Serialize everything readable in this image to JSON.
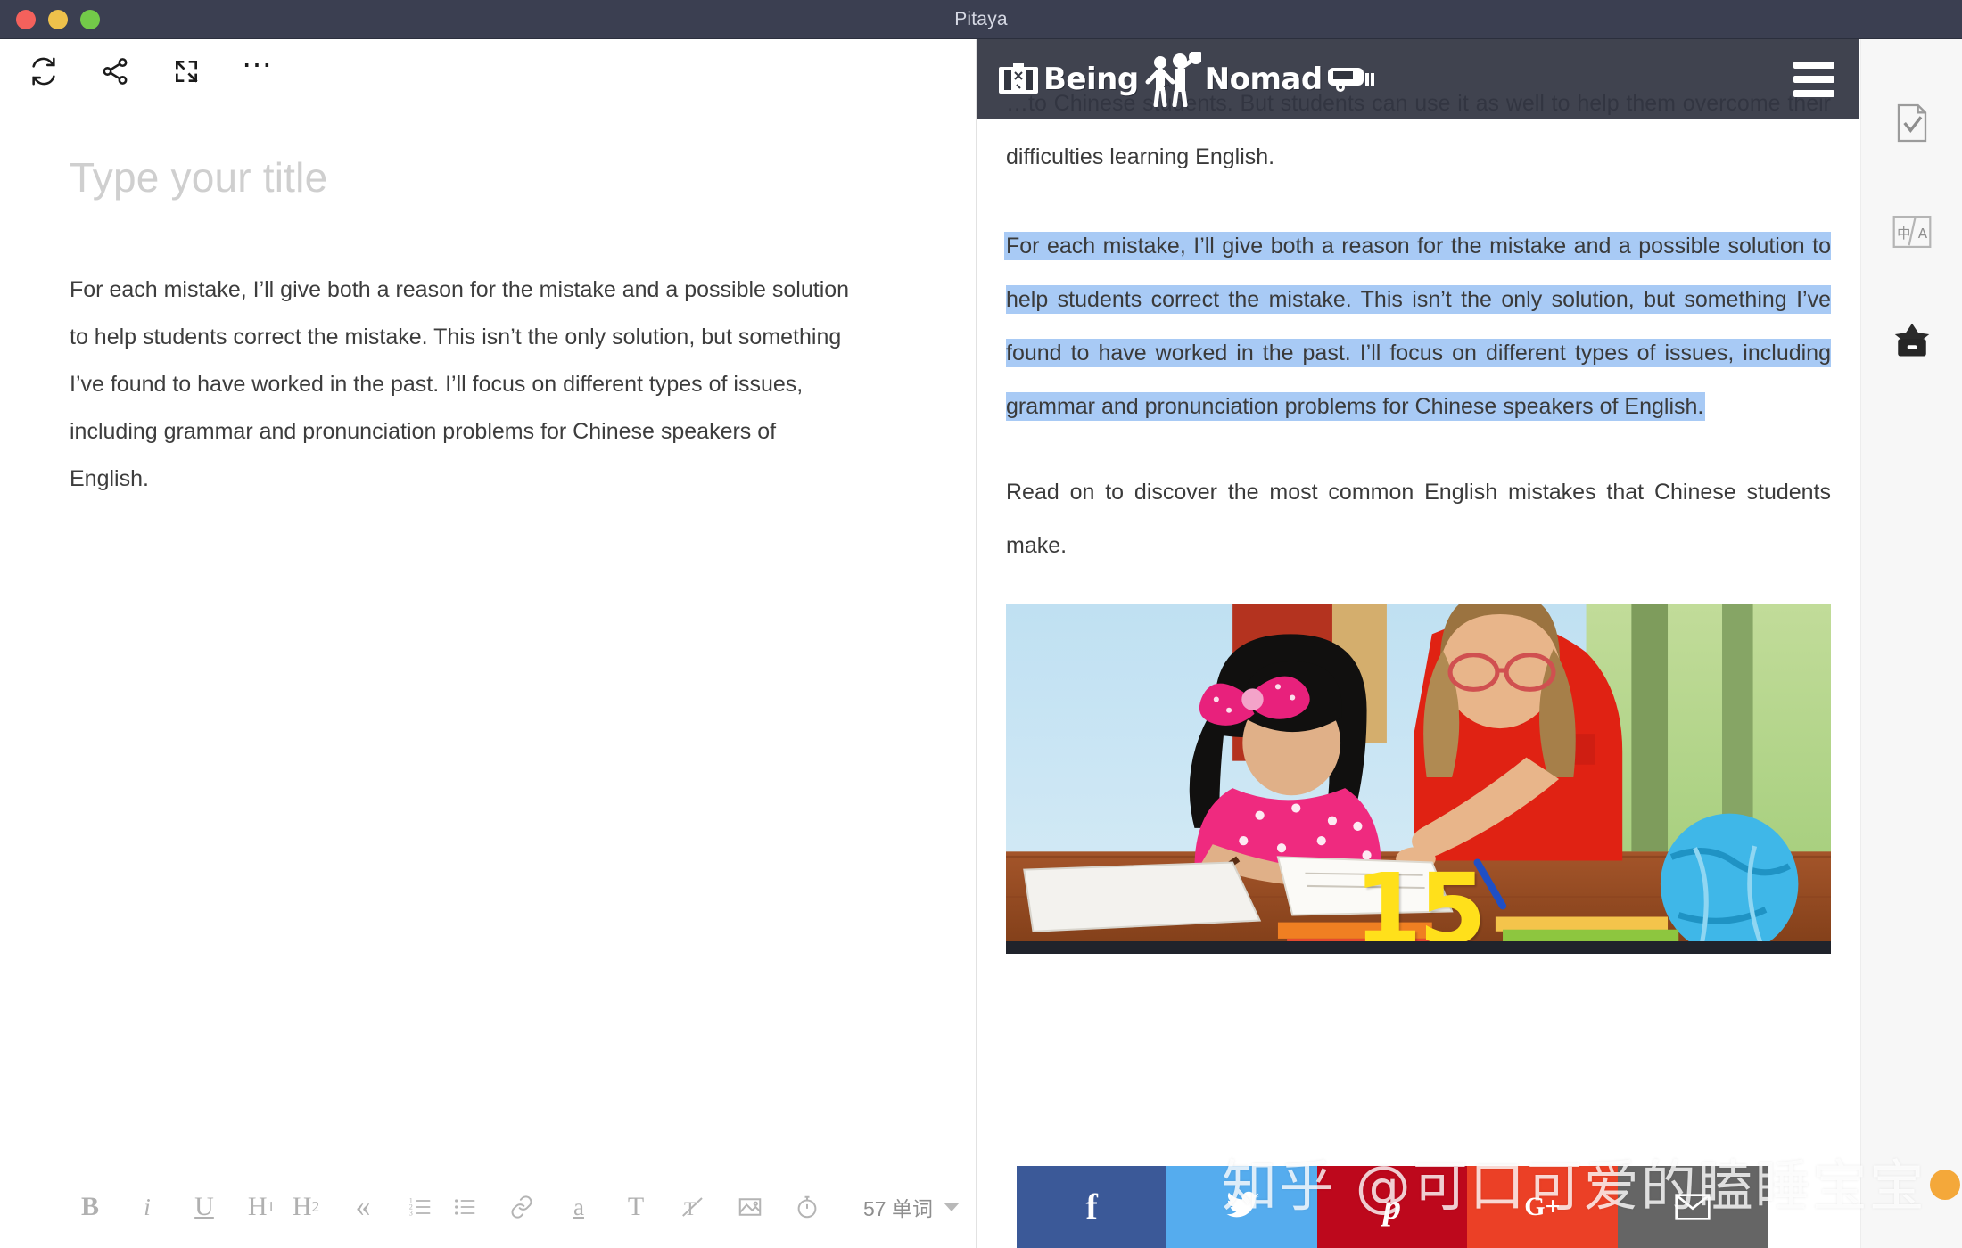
{
  "window": {
    "title": "Pitaya",
    "traffic_lights": [
      {
        "name": "close",
        "color": "#f4615c"
      },
      {
        "name": "minimize",
        "color": "#eec14b"
      },
      {
        "name": "zoom",
        "color": "#73c949"
      }
    ]
  },
  "editor": {
    "toolbar": [
      {
        "name": "sync-icon",
        "label": "Sync"
      },
      {
        "name": "share-icon",
        "label": "Share"
      },
      {
        "name": "fullscreen-icon",
        "label": "Fullscreen"
      },
      {
        "name": "more-icon",
        "label": "More"
      }
    ],
    "title_placeholder": "Type your title",
    "body": "For each mistake, I’ll give both a reason for the mistake and a possible solution to help students correct the mistake. This isn’t the only solution, but something I’ve found to have worked in the past. I’ll focus on different types of issues, including grammar and pronunciation problems for Chinese speakers of English."
  },
  "format_bar": {
    "items": [
      {
        "name": "bold-button",
        "label": "B"
      },
      {
        "name": "italic-button",
        "label": "i"
      },
      {
        "name": "underline-button",
        "label": "U"
      },
      {
        "name": "heading-1-button",
        "label": "H1"
      },
      {
        "name": "heading-2-button",
        "label": "H2"
      },
      {
        "name": "blockquote-button",
        "label": "“"
      },
      {
        "name": "ordered-list-button",
        "label": "ordered-list"
      },
      {
        "name": "bullet-list-button",
        "label": "bullet-list"
      },
      {
        "name": "link-button",
        "label": "link"
      },
      {
        "name": "highlight-button",
        "label": "a"
      },
      {
        "name": "text-style-button",
        "label": "T"
      },
      {
        "name": "clear-format-button",
        "label": "Tx"
      },
      {
        "name": "insert-image-button",
        "label": "image"
      },
      {
        "name": "timer-button",
        "label": "timer"
      }
    ],
    "word_count": "57 单词"
  },
  "preview": {
    "site_logo": "Being Nomad",
    "menu_label": "menu",
    "paragraph_top": "…to Chinese students. But students can use it as well to help them overcome their difficulties learning English.",
    "paragraph_highlighted": "For each mistake, I’ll give both a reason for the mistake and a possible solution to help students correct the mistake. This isn’t the only solution, but something I’ve found to have worked in the past. I’ll focus on different types of issues, including grammar and pronunciation problems for Chinese speakers of English.",
    "paragraph_after": "Read on to discover the most common English mistakes that Chinese students make.",
    "photo_number": "15",
    "highlight_color": "#a8caf5",
    "social": [
      {
        "name": "facebook",
        "glyph": "f",
        "color": "#3b5998"
      },
      {
        "name": "twitter",
        "glyph": "twitter-bird",
        "color": "#55acee"
      },
      {
        "name": "pinterest",
        "glyph": "p",
        "color": "#bd081c"
      },
      {
        "name": "googleplus",
        "glyph": "G+",
        "color": "#eb4026"
      },
      {
        "name": "email",
        "glyph": "envelope",
        "color": "#656565"
      }
    ]
  },
  "watermark": {
    "text": "知乎 @可口可爱的瞌睡宝宝"
  },
  "sidebar": {
    "items": [
      {
        "name": "proofread-icon",
        "label": "Proofread"
      },
      {
        "name": "translate-icon",
        "label": "中/A"
      },
      {
        "name": "archive-icon",
        "label": "Archive"
      }
    ]
  }
}
